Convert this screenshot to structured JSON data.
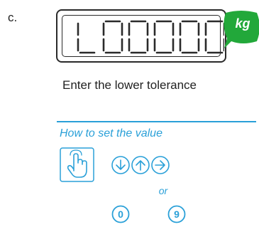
{
  "step_label": "c.",
  "display": {
    "value": "L00000",
    "unit": "kg"
  },
  "instruction": "Enter the lower tolerance",
  "howto": {
    "title": "How to set the value",
    "nav_icons": [
      "arrow-down-circle-icon",
      "arrow-up-circle-icon",
      "arrow-right-circle-icon"
    ],
    "or_label": "or",
    "digit_keys": [
      "0",
      "9"
    ]
  },
  "colors": {
    "accent": "#2aa0d8",
    "unit_bubble": "#22a83a",
    "lcd_frame": "#2a2a2a"
  }
}
